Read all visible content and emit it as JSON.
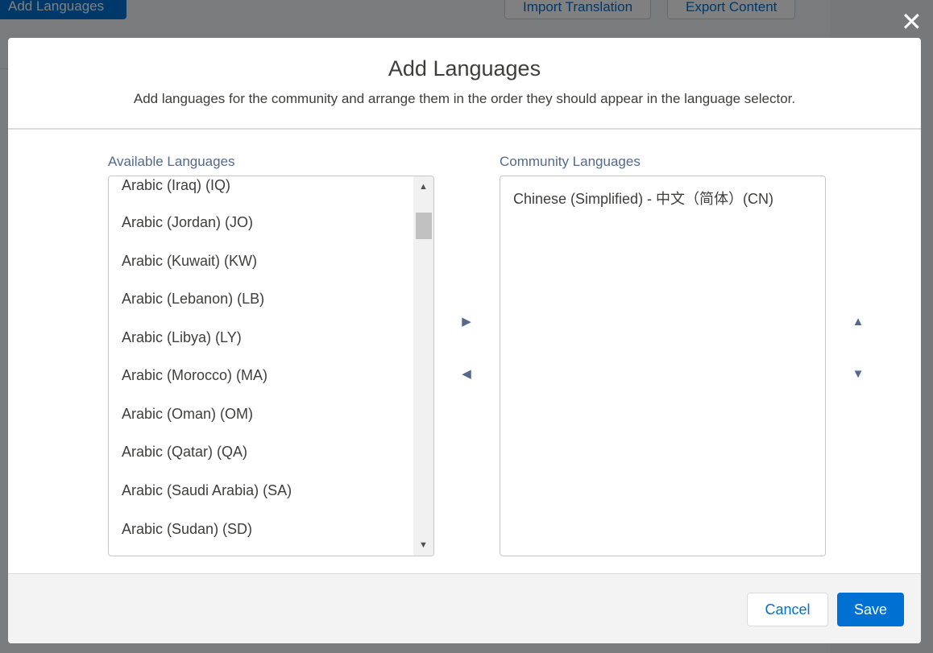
{
  "background": {
    "primary_button": "Add Languages",
    "import_button": "Import Translation",
    "export_button": "Export Content"
  },
  "modal": {
    "title": "Add Languages",
    "subtitle": "Add languages for the community and arrange them in the order they should appear in the language selector.",
    "available_label": "Available Languages",
    "community_label": "Community Languages",
    "available_languages": [
      "Arabic (Iraq) (IQ)",
      "Arabic (Jordan) (JO)",
      "Arabic (Kuwait) (KW)",
      "Arabic (Lebanon) (LB)",
      "Arabic (Libya) (LY)",
      "Arabic (Morocco) (MA)",
      "Arabic (Oman) (OM)",
      "Arabic (Qatar) (QA)",
      "Arabic (Saudi Arabia) (SA)",
      "Arabic (Sudan) (SD)"
    ],
    "community_languages": [
      "Chinese (Simplified) - 中文（简体）(CN)"
    ],
    "cancel_label": "Cancel",
    "save_label": "Save"
  },
  "colors": {
    "brand": "#0070d2",
    "label": "#54698d",
    "text": "#3e3e3c"
  }
}
